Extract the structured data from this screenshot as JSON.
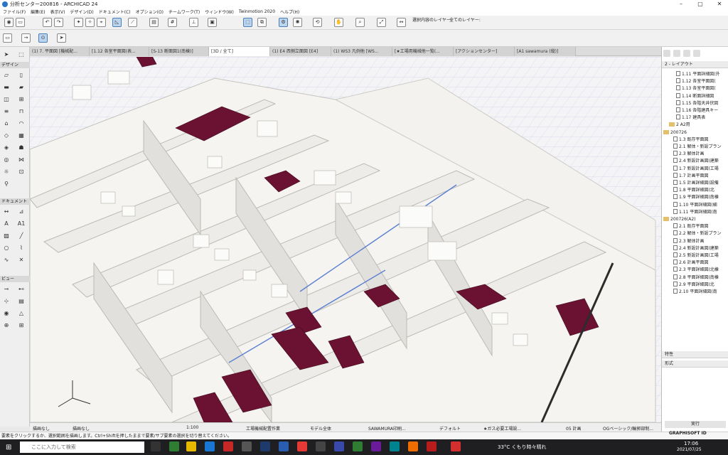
{
  "window": {
    "title": "分析センター200816 - ARCHICAD 24"
  },
  "menu": [
    "ファイル(F)",
    "編集(E)",
    "表示(V)",
    "デザイン(D)",
    "ドキュメント(C)",
    "オプション(O)",
    "チームワーク(T)",
    "ウィンドウ(W)",
    "Twinmotion 2020",
    "ヘルプ(H)"
  ],
  "toolbar": {
    "layer_label": "選択内容のレイヤー:",
    "layer_all": "全てのレイヤー:"
  },
  "tabs": [
    "(1) 7. 平面図 [機械配...",
    "[1.12 各室平面図(表...",
    "[S-13 断面図1(南棟)]",
    "[3D / 全て]",
    "(1) E4 西側立面図 [E4]",
    "(1) WS3 凡例他 [WS...",
    "[★工場用機械他一覧(...",
    "[アクションセンター]",
    "[A1 sawamura (縦)]"
  ],
  "toolbox": {
    "design": "デザイン",
    "document": "ドキュメント",
    "view": "ビュー"
  },
  "navigator": {
    "header": "2 - レイアウト",
    "items": [
      "1.11 平面詳細図(外",
      "1.12 各室平面図(",
      "1.13 各室平面図(",
      "1.14 断面詳細図",
      "1.15 各階天井伏図",
      "1.16 各階建具キー",
      "1.17 建具表"
    ],
    "subset_a2": "2 A2用",
    "group1": "200726",
    "group1_items": [
      "1.3 既存平面図",
      "2.1 解体・新設プラン",
      "2.3 解体計画",
      "2.4 新設計画図(建築",
      "1.7 新設計画図(工場",
      "1.7 計画平面図",
      "1.5 計画詳細図(設備",
      "1.8 平面詳細図(北",
      "1.9 平面詳細図(南棟",
      "1.10 平面詳細図(細",
      "1.11 平面詳細図(南"
    ],
    "group2": "200726(A2)",
    "group2_items": [
      "2.1 既存平面図",
      "2.2 解体・新設プラン",
      "2.3 解体計画",
      "2.4 新設計画図(建築",
      "2.5 新設計画図(工場",
      "2.6 計画平面図",
      "2.3 平面詳細図(北棟",
      "2.8 平面詳細図(南棟",
      "2.9 平面詳細図(北",
      "2.10 平面詳細図(南"
    ],
    "section_props": "特性",
    "section_format": "形式",
    "run_button": "実行",
    "brand": "GRAPHISOFT ID"
  },
  "status": {
    "undo": "描画なし",
    "scale": "1:100",
    "layer_combo": "工場機械配置作業",
    "model": "モデル全体",
    "user": "SAWAMURA印刷...",
    "pen": "デフォルト",
    "gas": "★ガス必要工場設...",
    "reno": "05 計画",
    "mvo": "OGベーシック/輪郭部制...",
    "extra": "描画なし"
  },
  "info": "要素をクリックするか、選択範囲を描画します。Ctrl+Shiftを押したままで要素/サブ要素の選択を切り替えてください。",
  "taskbar": {
    "search_placeholder": "ここに入力して検索",
    "weather": "33°C くもり時々晴れ",
    "time": "17:06",
    "date": "2021/07/25"
  },
  "colors": {
    "wall": "#f2f1ee",
    "wall_side": "#d9d7d2",
    "equip_dark": "#6b1232",
    "floor": "#fafafa",
    "grid": "#c9cfe6"
  }
}
